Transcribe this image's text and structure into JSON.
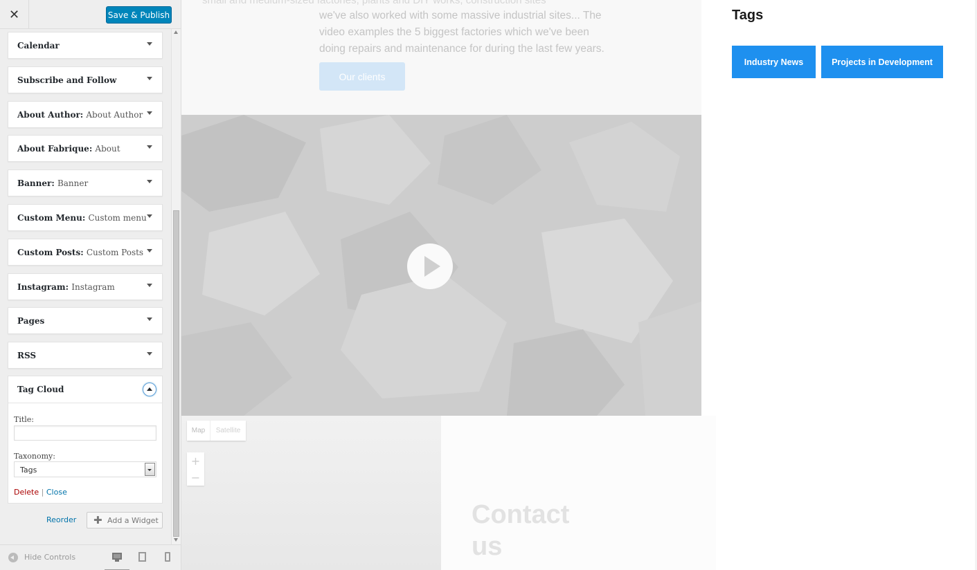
{
  "header": {
    "close_icon_glyph": "✕",
    "save_label": "Save & Publish"
  },
  "widgets": [
    {
      "title": "Calendar",
      "subtitle": ""
    },
    {
      "title": "Subscribe and Follow",
      "subtitle": ""
    },
    {
      "title": "About Author",
      "subtitle": "About Author"
    },
    {
      "title": "About Fabrique",
      "subtitle": "About"
    },
    {
      "title": "Banner",
      "subtitle": "Banner"
    },
    {
      "title": "Custom Menu",
      "subtitle": "Custom menu"
    },
    {
      "title": "Custom Posts",
      "subtitle": "Custom Posts"
    },
    {
      "title": "Instagram",
      "subtitle": "Instagram"
    },
    {
      "title": "Pages",
      "subtitle": ""
    },
    {
      "title": "RSS",
      "subtitle": ""
    }
  ],
  "tag_cloud_widget": {
    "title": "Tag Cloud",
    "title_field_label": "Title:",
    "title_field_value": "",
    "taxonomy_label": "Taxonomy:",
    "taxonomy_value": "Tags",
    "delete_label": "Delete",
    "separator": "|",
    "close_label": "Close"
  },
  "footer_actions": {
    "reorder_label": "Reorder",
    "add_widget_label": "Add a Widget",
    "add_widget_glyph": "✚"
  },
  "sidebar_footer": {
    "hide_controls_label": "Hide Controls"
  },
  "preview": {
    "cut_text": "small and medium-sized factories, plants and DIY works, construction sites",
    "about_text": "we've also worked with some massive industrial sites... The video examples the 5 biggest factories which we've been doing repairs and maintenance for during the last few years.",
    "clients_button": "Our clients",
    "map_button": "Map",
    "satellite_button": "Satellite",
    "zoom_in": "+",
    "zoom_out": "−",
    "contact_title": "Contact us",
    "tags_heading": "Tags",
    "tags": [
      "Industry News",
      "Projects in Development"
    ]
  },
  "colors": {
    "primary": "#0085ba",
    "tag_blue": "#1e90ef",
    "link": "#0073aa",
    "delete": "#aa0000"
  }
}
